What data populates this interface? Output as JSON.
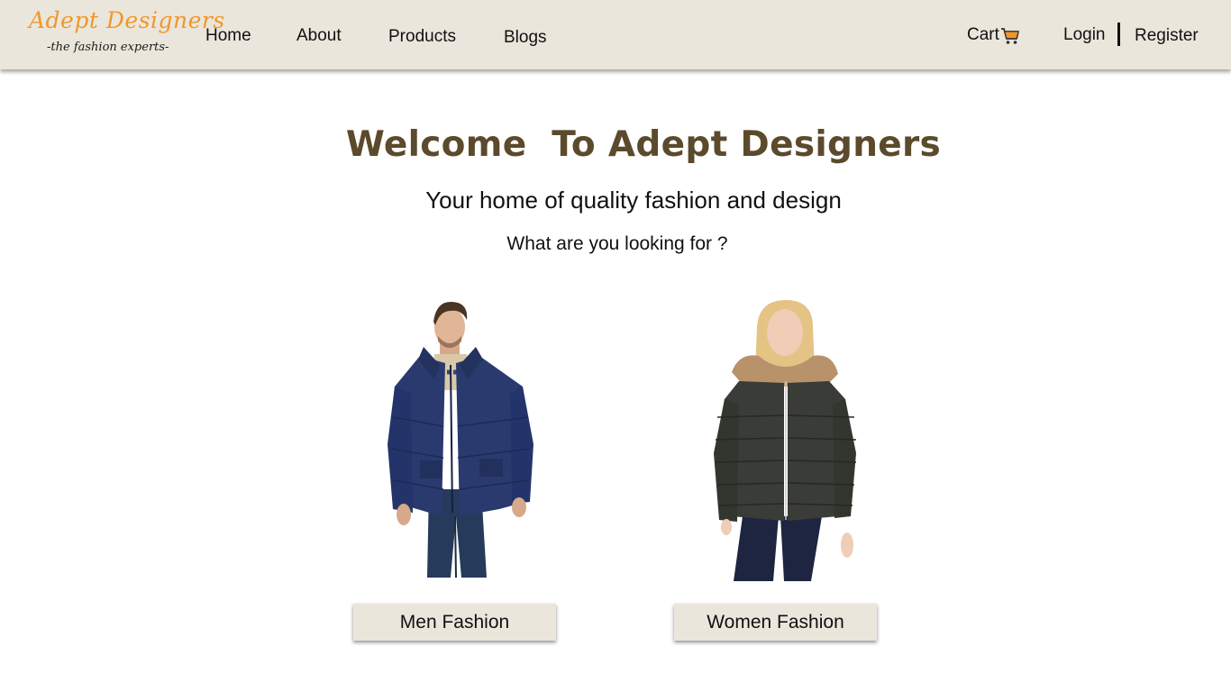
{
  "brand": {
    "name": "Adept Designers",
    "tagline": "-the fashion experts-",
    "color": "#f1972a"
  },
  "nav": {
    "links": [
      "Home",
      "About",
      "Products",
      "Blogs"
    ],
    "cart_label": "Cart",
    "login_label": "Login",
    "register_label": "Register",
    "background": "#ebe6dc",
    "cart_icon": "shopping-cart-icon",
    "cart_icon_color": "#f1972a"
  },
  "hero": {
    "title": "Welcome  To Adept Designers",
    "title_color": "#5b4a2b",
    "subtitle": "Your home of quality fashion and design",
    "question": "What are you looking for ?"
  },
  "categories": [
    {
      "label": "Men Fashion",
      "image": "man-in-navy-puffer-jacket"
    },
    {
      "label": "Women Fashion",
      "image": "woman-in-black-puffer-jacket"
    }
  ]
}
